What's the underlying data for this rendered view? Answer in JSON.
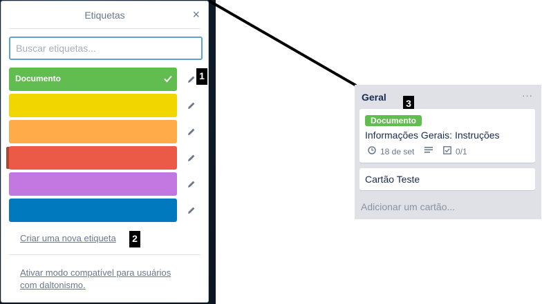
{
  "popover": {
    "title": "Etiquetas",
    "close_glyph": "×",
    "search_placeholder": "Buscar etiquetas...",
    "labels": [
      {
        "name": "Documento",
        "color": "#61bd4f",
        "checked": true
      },
      {
        "name": "",
        "color": "#f2d600",
        "checked": false
      },
      {
        "name": "",
        "color": "#ffab4a",
        "checked": false
      },
      {
        "name": "",
        "color": "#eb5a46",
        "checked": false
      },
      {
        "name": "",
        "color": "#c377e0",
        "checked": false
      },
      {
        "name": "",
        "color": "#0079bf",
        "checked": false
      }
    ],
    "create_label": "Criar uma nova etiqueta",
    "colorblind_line1": "Ativar modo compatível para usuários",
    "colorblind_line2": "com daltonismo."
  },
  "annotations": {
    "one": "1",
    "two": "2",
    "three": "3"
  },
  "list": {
    "title": "Geral",
    "menu_glyph": "···",
    "cards": [
      {
        "label": "Documento",
        "title": "Informações Gerais: Instruções",
        "due": "18 de set",
        "checklist": "0/1"
      },
      {
        "title": "Cartão Teste"
      }
    ],
    "add_card": "Adicionar um cartão..."
  },
  "icons": [
    "close-icon",
    "check-icon",
    "pencil-icon",
    "clock-icon",
    "description-icon",
    "checklist-icon"
  ]
}
